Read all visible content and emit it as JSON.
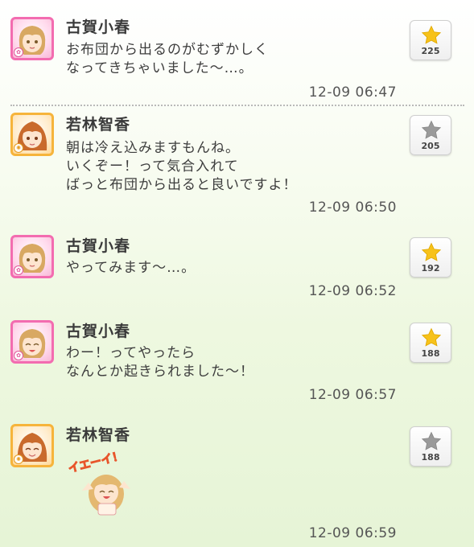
{
  "messages": [
    {
      "name": "古賀小春",
      "lines": [
        "お布団から出るのがむずかしく",
        "なってきちゃいました〜…。"
      ],
      "time": "12-09 06:47",
      "likes": "225",
      "liked": true,
      "avatar": "pink"
    },
    {
      "name": "若林智香",
      "lines": [
        "朝は冷え込みますもんね。",
        "いくぞー！って気合入れて",
        "ばっと布団から出ると良いですよ！"
      ],
      "time": "12-09 06:50",
      "likes": "205",
      "liked": false,
      "avatar": "orange"
    },
    {
      "name": "古賀小春",
      "lines": [
        "やってみます〜…。"
      ],
      "time": "12-09 06:52",
      "likes": "192",
      "liked": true,
      "avatar": "pink"
    },
    {
      "name": "古賀小春",
      "lines": [
        "わー！ってやったら",
        "なんとか起きられました〜！"
      ],
      "time": "12-09 06:57",
      "likes": "188",
      "liked": true,
      "avatar": "pink"
    },
    {
      "name": "若林智香",
      "lines": [],
      "sticker_text": "イエーイ！",
      "time": "12-09 06:59",
      "likes": "188",
      "liked": false,
      "avatar": "orange"
    }
  ],
  "colors": {
    "star_active": "#f7c21a",
    "star_inactive": "#9a9a9a",
    "pink": "#f36cb0",
    "orange": "#f6b43b"
  }
}
